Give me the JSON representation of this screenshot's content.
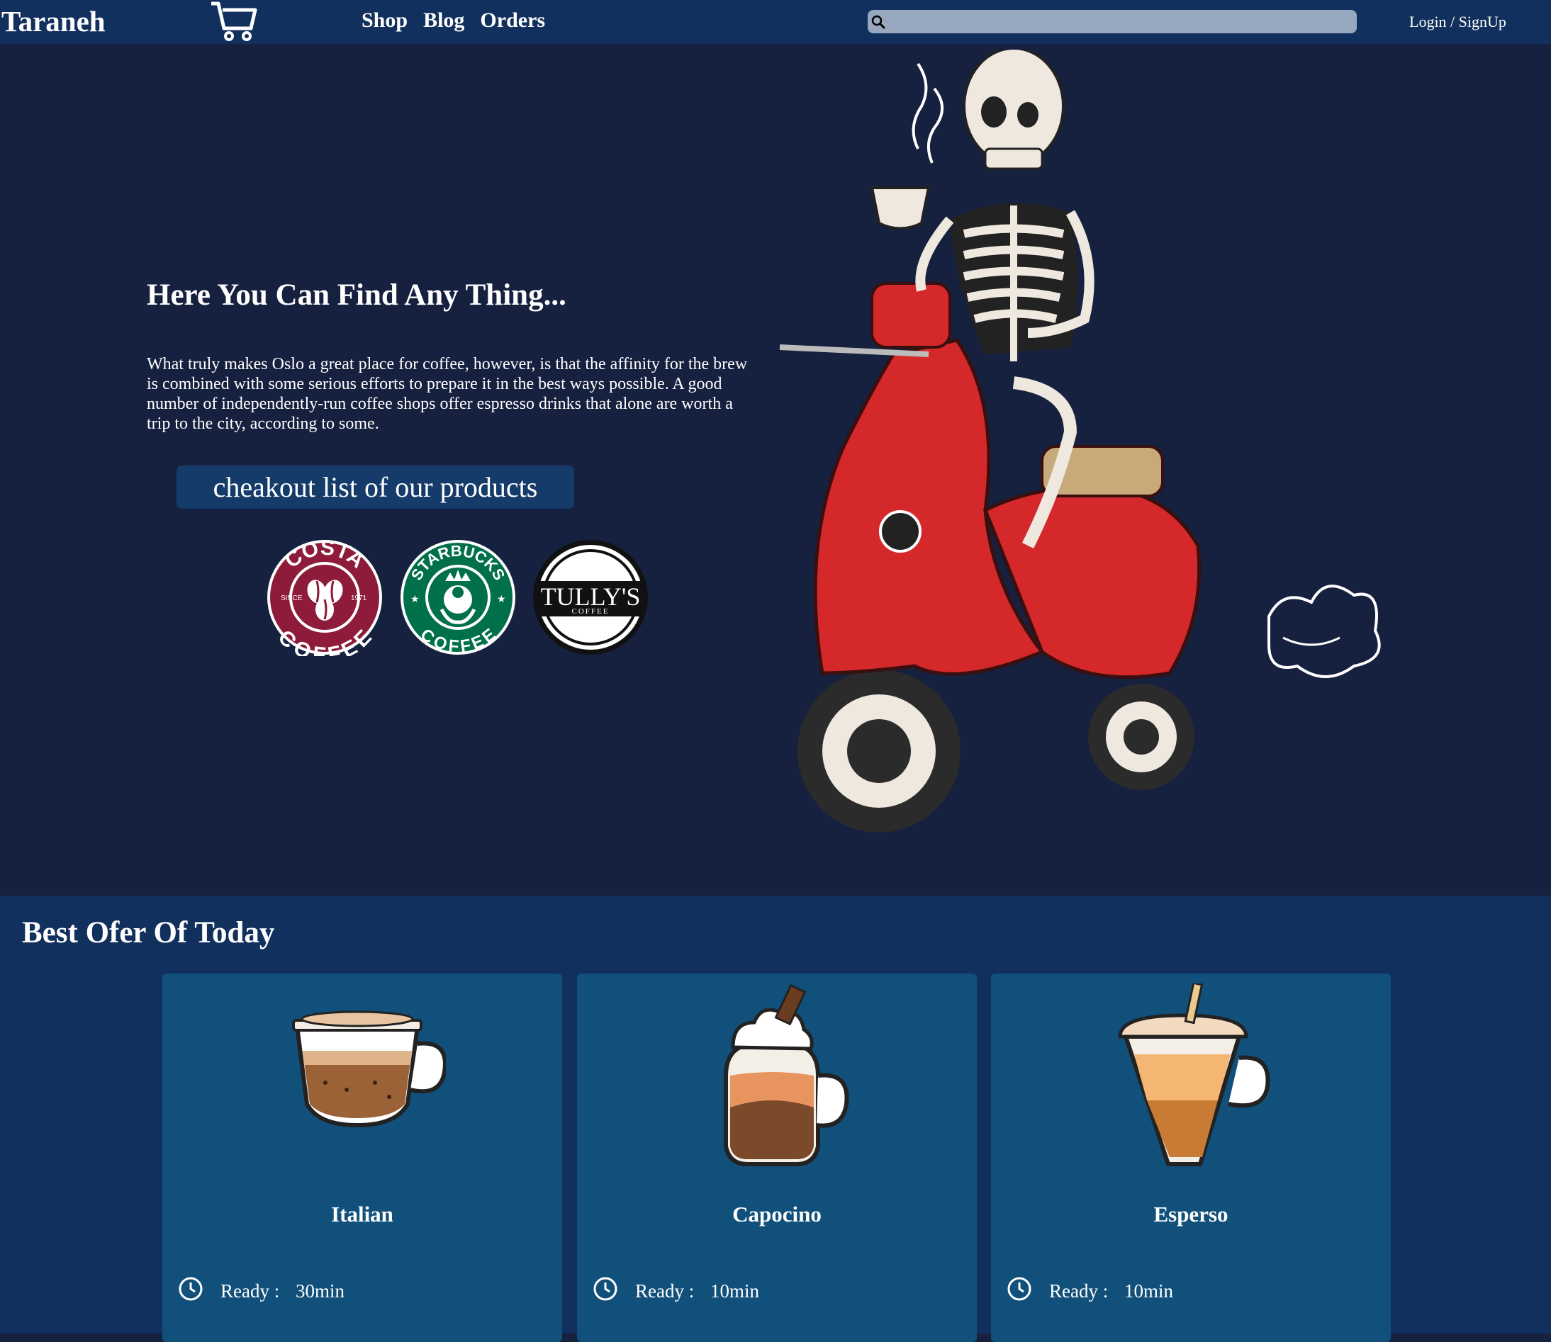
{
  "nav": {
    "brand": "Taraneh",
    "cart_count": "0",
    "links": [
      "Shop",
      "Blog",
      "Orders"
    ],
    "search_placeholder": "",
    "login": "Login / SignUp"
  },
  "hero": {
    "title": "Here You Can Find Any Thing...",
    "text": "What truly makes Oslo a great place for coffee, however, is that the affinity for the brew is combined with some serious efforts to prepare it in the best ways possible. A good number of independently-run coffee shops offer espresso drinks that alone are worth a trip to the city, according to some.",
    "cta": "cheakout list of our products",
    "logos": {
      "costa": {
        "top": "COSTA",
        "bottom": "COFFEE",
        "left": "SINCE",
        "right": "1971"
      },
      "starbucks": {
        "top": "STARBUCKS",
        "bottom": "COFFEE"
      },
      "tullys": {
        "name": "TULLY'S",
        "sub": "COFFEE"
      }
    }
  },
  "offers": {
    "title": "Best Ofer Of Today",
    "ready_label": "Ready :",
    "items": [
      {
        "name": "Italian",
        "time": "30min"
      },
      {
        "name": "Capocino",
        "time": "10min"
      },
      {
        "name": "Esperso",
        "time": "10min"
      }
    ]
  },
  "colors": {
    "page_bg": "#16203f",
    "navbar_bg": "#12305d",
    "card_bg": "#11507b",
    "search_bg": "#98a9bf",
    "scooter_red": "#d4282a"
  }
}
